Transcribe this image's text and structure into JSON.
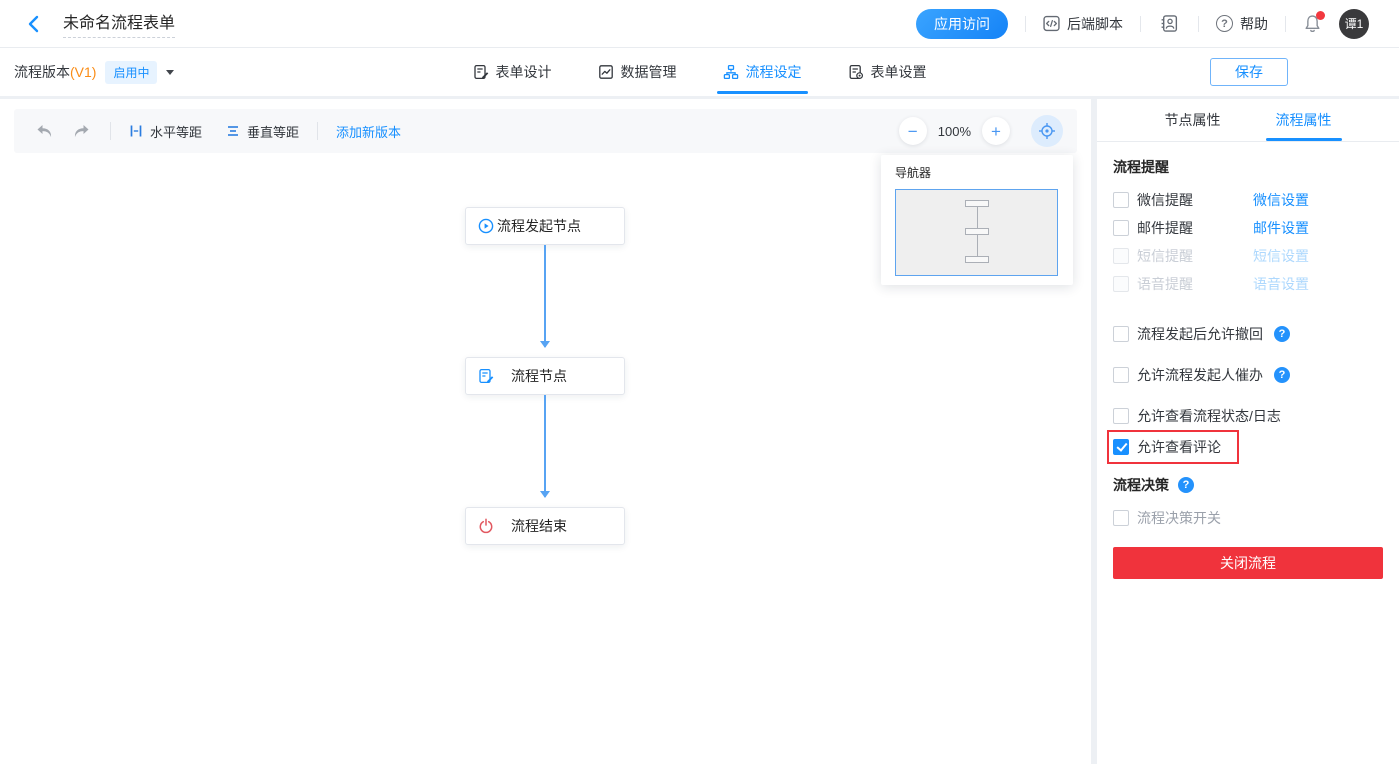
{
  "colors": {
    "accent_blue": "#1890ff",
    "danger_red": "#f0333c",
    "version_orange": "#fa8c16",
    "badge_bg": "#e7f3ff",
    "arrow_blue": "#57a3f3",
    "end_node_red": "#e25860",
    "disabled_text": "#c9ced6",
    "disabled_link": "#aed8fd"
  },
  "icons": {
    "help_glyph": "?",
    "question_badge_glyph": "?",
    "zoom_out_glyph": "−",
    "zoom_in_glyph": "+"
  },
  "header": {
    "title": "未命名流程表单",
    "app_access": "应用访问",
    "backend_script": "后端脚本",
    "help": "帮助",
    "avatar": "谭1"
  },
  "version_bar": {
    "version_label": "流程版本",
    "version_tag": "(V1)",
    "status": "启用中",
    "tabs": [
      {
        "label": "表单设计",
        "active": false
      },
      {
        "label": "数据管理",
        "active": false
      },
      {
        "label": "流程设定",
        "active": true
      },
      {
        "label": "表单设置",
        "active": false
      }
    ],
    "save": "保存"
  },
  "canvas": {
    "toolbar": {
      "h_equal": "水平等距",
      "v_equal": "垂直等距",
      "add_version": "添加新版本",
      "zoom": "100%"
    },
    "navigator_title": "导航器",
    "nodes": [
      {
        "label": "流程发起节点",
        "icon": "play-circle"
      },
      {
        "label": "流程节点",
        "icon": "form-edit"
      },
      {
        "label": "流程结束",
        "icon": "power"
      }
    ]
  },
  "panel": {
    "tabs": [
      {
        "label": "节点属性",
        "active": false
      },
      {
        "label": "流程属性",
        "active": true
      }
    ],
    "reminder_title": "流程提醒",
    "reminders": [
      {
        "label": "微信提醒",
        "link": "微信设置",
        "checked": false,
        "disabled": false
      },
      {
        "label": "邮件提醒",
        "link": "邮件设置",
        "checked": false,
        "disabled": false
      },
      {
        "label": "短信提醒",
        "link": "短信设置",
        "checked": false,
        "disabled": true
      },
      {
        "label": "语音提醒",
        "link": "语音设置",
        "checked": false,
        "disabled": true
      }
    ],
    "options": [
      {
        "label": "流程发起后允许撤回",
        "checked": false,
        "help": true
      },
      {
        "label": "允许流程发起人催办",
        "checked": false,
        "help": true
      },
      {
        "label": "允许查看流程状态/日志",
        "checked": false,
        "help": false
      },
      {
        "label": "允许查看评论",
        "checked": true,
        "help": false,
        "highlighted": true
      }
    ],
    "decision_title": "流程决策",
    "decision_option": "流程决策开关",
    "close_button": "关闭流程"
  }
}
